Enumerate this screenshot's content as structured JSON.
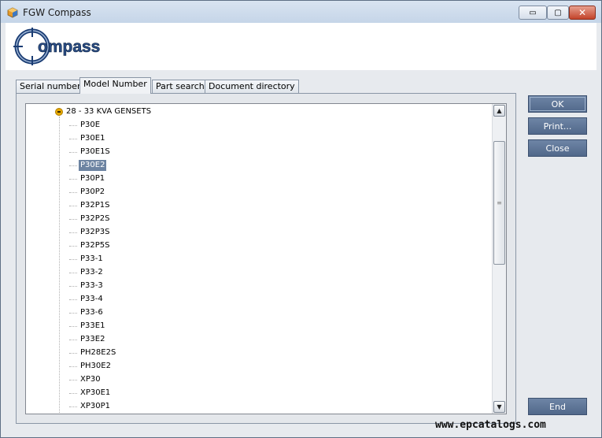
{
  "window": {
    "title": "FGW Compass",
    "controls": {
      "minimize": "▭",
      "maximize": "▢",
      "close": "✕"
    }
  },
  "logo": {
    "text": "ompass",
    "letter": "C"
  },
  "tabs": [
    {
      "label": "Serial number",
      "active": false
    },
    {
      "label": "Model Number",
      "active": true
    },
    {
      "label": "Part search",
      "active": false
    },
    {
      "label": "Document directory",
      "active": false
    }
  ],
  "tree": {
    "root_label": "28 - 33 KVA GENSETS",
    "items": [
      "P30E",
      "P30E1",
      "P30E1S",
      "P30E2",
      "P30P1",
      "P30P2",
      "P32P1S",
      "P32P2S",
      "P32P3S",
      "P32P5S",
      "P33-1",
      "P33-2",
      "P33-3",
      "P33-4",
      "P33-6",
      "P33E1",
      "P33E2",
      "PH28E2S",
      "PH30E2",
      "XP30",
      "XP30E1",
      "XP30P1"
    ],
    "selected": "P30E2"
  },
  "buttons": {
    "ok": "OK",
    "print": "Print...",
    "close": "Close",
    "end": "End"
  },
  "watermark": "www.epcatalogs.com",
  "colors": {
    "button_bg": "#5d7497",
    "selection": "#6d84a2",
    "collapse_icon": "#e6a900"
  }
}
